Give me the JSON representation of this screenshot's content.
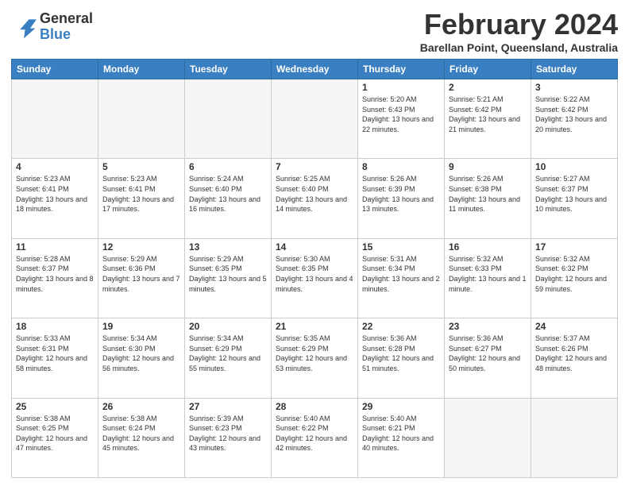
{
  "logo": {
    "general": "General",
    "blue": "Blue"
  },
  "title": "February 2024",
  "subtitle": "Barellan Point, Queensland, Australia",
  "headers": [
    "Sunday",
    "Monday",
    "Tuesday",
    "Wednesday",
    "Thursday",
    "Friday",
    "Saturday"
  ],
  "weeks": [
    [
      {
        "day": "",
        "info": ""
      },
      {
        "day": "",
        "info": ""
      },
      {
        "day": "",
        "info": ""
      },
      {
        "day": "",
        "info": ""
      },
      {
        "day": "1",
        "info": "Sunrise: 5:20 AM\nSunset: 6:43 PM\nDaylight: 13 hours\nand 22 minutes."
      },
      {
        "day": "2",
        "info": "Sunrise: 5:21 AM\nSunset: 6:42 PM\nDaylight: 13 hours\nand 21 minutes."
      },
      {
        "day": "3",
        "info": "Sunrise: 5:22 AM\nSunset: 6:42 PM\nDaylight: 13 hours\nand 20 minutes."
      }
    ],
    [
      {
        "day": "4",
        "info": "Sunrise: 5:23 AM\nSunset: 6:41 PM\nDaylight: 13 hours\nand 18 minutes."
      },
      {
        "day": "5",
        "info": "Sunrise: 5:23 AM\nSunset: 6:41 PM\nDaylight: 13 hours\nand 17 minutes."
      },
      {
        "day": "6",
        "info": "Sunrise: 5:24 AM\nSunset: 6:40 PM\nDaylight: 13 hours\nand 16 minutes."
      },
      {
        "day": "7",
        "info": "Sunrise: 5:25 AM\nSunset: 6:40 PM\nDaylight: 13 hours\nand 14 minutes."
      },
      {
        "day": "8",
        "info": "Sunrise: 5:26 AM\nSunset: 6:39 PM\nDaylight: 13 hours\nand 13 minutes."
      },
      {
        "day": "9",
        "info": "Sunrise: 5:26 AM\nSunset: 6:38 PM\nDaylight: 13 hours\nand 11 minutes."
      },
      {
        "day": "10",
        "info": "Sunrise: 5:27 AM\nSunset: 6:37 PM\nDaylight: 13 hours\nand 10 minutes."
      }
    ],
    [
      {
        "day": "11",
        "info": "Sunrise: 5:28 AM\nSunset: 6:37 PM\nDaylight: 13 hours\nand 8 minutes."
      },
      {
        "day": "12",
        "info": "Sunrise: 5:29 AM\nSunset: 6:36 PM\nDaylight: 13 hours\nand 7 minutes."
      },
      {
        "day": "13",
        "info": "Sunrise: 5:29 AM\nSunset: 6:35 PM\nDaylight: 13 hours\nand 5 minutes."
      },
      {
        "day": "14",
        "info": "Sunrise: 5:30 AM\nSunset: 6:35 PM\nDaylight: 13 hours\nand 4 minutes."
      },
      {
        "day": "15",
        "info": "Sunrise: 5:31 AM\nSunset: 6:34 PM\nDaylight: 13 hours\nand 2 minutes."
      },
      {
        "day": "16",
        "info": "Sunrise: 5:32 AM\nSunset: 6:33 PM\nDaylight: 13 hours\nand 1 minute."
      },
      {
        "day": "17",
        "info": "Sunrise: 5:32 AM\nSunset: 6:32 PM\nDaylight: 12 hours\nand 59 minutes."
      }
    ],
    [
      {
        "day": "18",
        "info": "Sunrise: 5:33 AM\nSunset: 6:31 PM\nDaylight: 12 hours\nand 58 minutes."
      },
      {
        "day": "19",
        "info": "Sunrise: 5:34 AM\nSunset: 6:30 PM\nDaylight: 12 hours\nand 56 minutes."
      },
      {
        "day": "20",
        "info": "Sunrise: 5:34 AM\nSunset: 6:29 PM\nDaylight: 12 hours\nand 55 minutes."
      },
      {
        "day": "21",
        "info": "Sunrise: 5:35 AM\nSunset: 6:29 PM\nDaylight: 12 hours\nand 53 minutes."
      },
      {
        "day": "22",
        "info": "Sunrise: 5:36 AM\nSunset: 6:28 PM\nDaylight: 12 hours\nand 51 minutes."
      },
      {
        "day": "23",
        "info": "Sunrise: 5:36 AM\nSunset: 6:27 PM\nDaylight: 12 hours\nand 50 minutes."
      },
      {
        "day": "24",
        "info": "Sunrise: 5:37 AM\nSunset: 6:26 PM\nDaylight: 12 hours\nand 48 minutes."
      }
    ],
    [
      {
        "day": "25",
        "info": "Sunrise: 5:38 AM\nSunset: 6:25 PM\nDaylight: 12 hours\nand 47 minutes."
      },
      {
        "day": "26",
        "info": "Sunrise: 5:38 AM\nSunset: 6:24 PM\nDaylight: 12 hours\nand 45 minutes."
      },
      {
        "day": "27",
        "info": "Sunrise: 5:39 AM\nSunset: 6:23 PM\nDaylight: 12 hours\nand 43 minutes."
      },
      {
        "day": "28",
        "info": "Sunrise: 5:40 AM\nSunset: 6:22 PM\nDaylight: 12 hours\nand 42 minutes."
      },
      {
        "day": "29",
        "info": "Sunrise: 5:40 AM\nSunset: 6:21 PM\nDaylight: 12 hours\nand 40 minutes."
      },
      {
        "day": "",
        "info": ""
      },
      {
        "day": "",
        "info": ""
      }
    ]
  ]
}
